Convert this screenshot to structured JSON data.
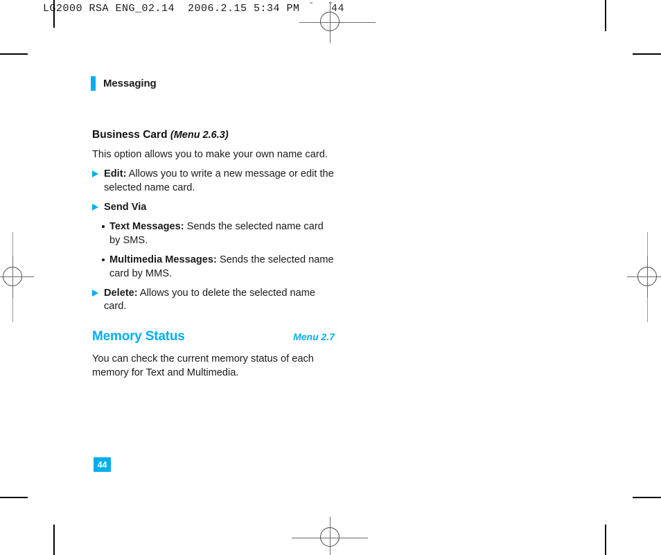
{
  "scan": {
    "slug_text": "LG2000 RSA ENG_02.14  2006.2.15 5:34 PM",
    "slug_page": "44",
    "tick_mark_1": "˘",
    "tick_mark_2": "˘"
  },
  "running_head": {
    "title": "Messaging",
    "accent_color": "#00AEEF"
  },
  "content": {
    "section": {
      "title": "Business Card",
      "menu_ref": "(Menu 2.6.3)",
      "intro": "This option allows you to make your own name card."
    },
    "bullets": [
      {
        "icon": "triangle-bullet",
        "label": "Edit:",
        "text": " Allows you to write a new message or edit the selected name card."
      },
      {
        "icon": "triangle-bullet",
        "label": "Send Via",
        "text": ""
      }
    ],
    "sub_bullets": [
      {
        "icon": "dot-bullet",
        "label": "Text Messages:",
        "text": " Sends the selected name card by SMS."
      },
      {
        "icon": "dot-bullet",
        "label": "Multimedia Messages:",
        "text": " Sends the selected name card by MMS."
      }
    ],
    "bullets_after": [
      {
        "icon": "triangle-bullet",
        "label": "Delete:",
        "text": " Allows you to delete the selected name card."
      }
    ],
    "menu_section": {
      "title": "Memory Status",
      "menu_ref": "Menu 2.7",
      "accent_color": "#00AEEF",
      "body": "You can check the current memory status of each memory for Text and Multimedia."
    }
  },
  "folio": {
    "page_number": "44",
    "background_color": "#00AEEF",
    "text_color": "#FFFFFF"
  }
}
